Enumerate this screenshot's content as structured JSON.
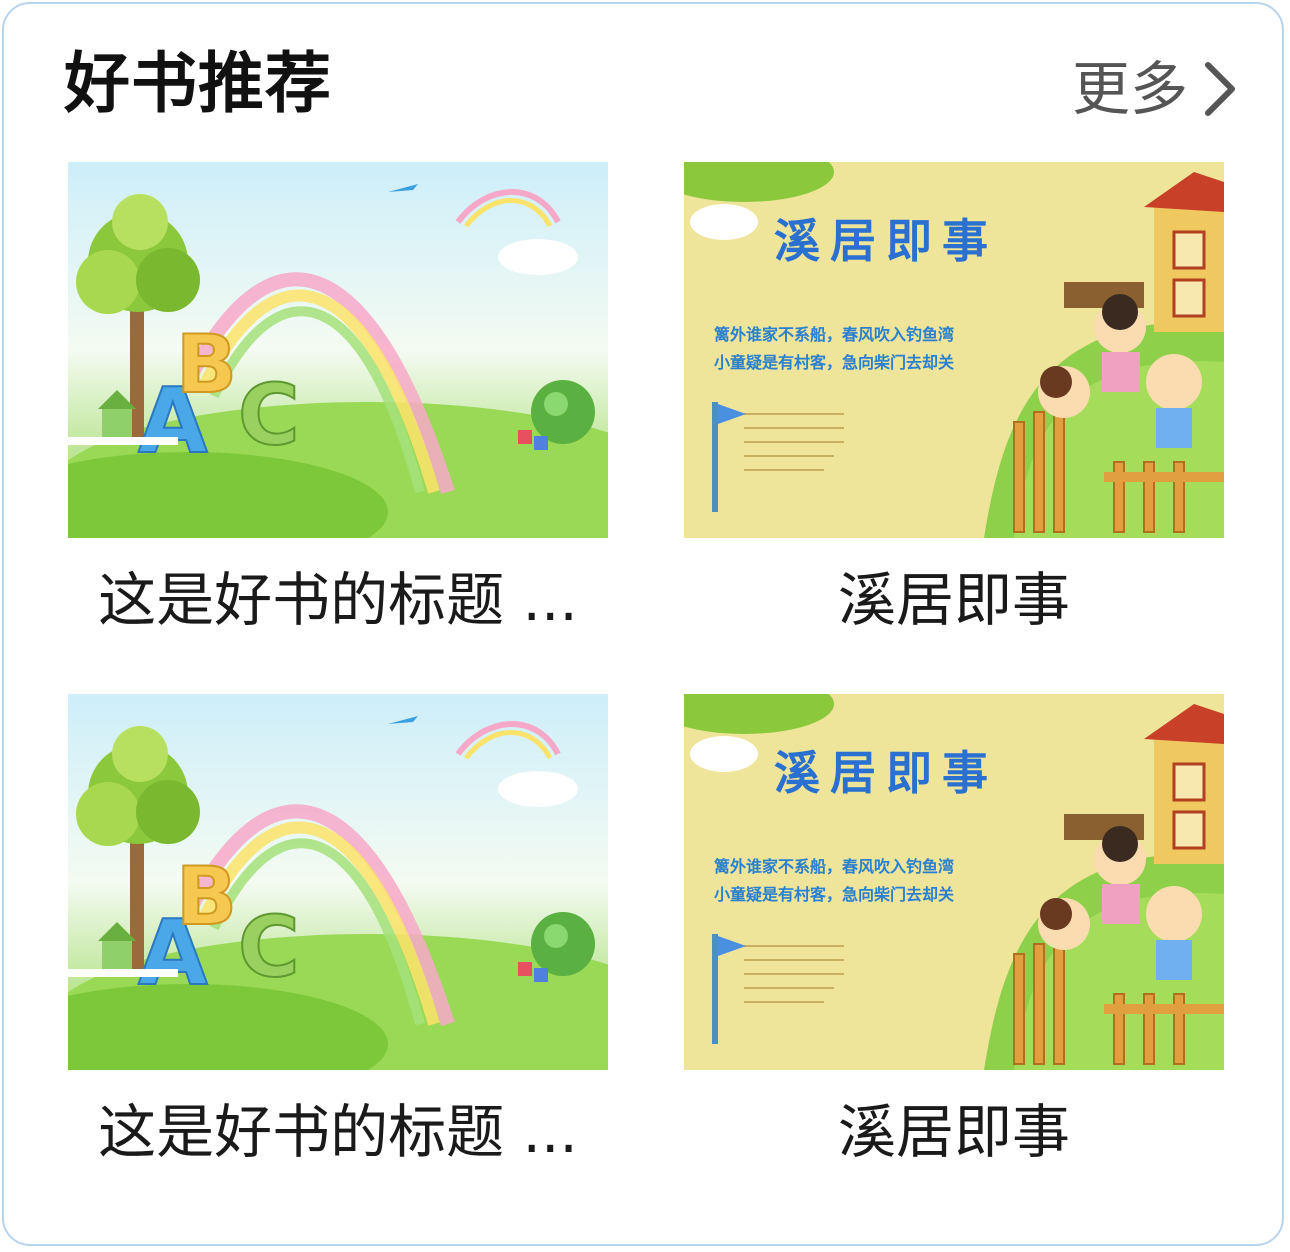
{
  "section": {
    "title": "好书推荐",
    "more_label": "更多",
    "more_icon": "chevron-right-icon"
  },
  "books": [
    {
      "title": "这是好书的标题 ...",
      "cover": {
        "style": "abc-rainbow",
        "letters": [
          "A",
          "B",
          "C"
        ]
      }
    },
    {
      "title": "溪居即事",
      "cover": {
        "style": "poem-village",
        "heading": "溪居即事",
        "line1": "篱外谁家不系船，春风吹入钓鱼湾",
        "line2": "小童疑是有村客，急向柴门去却关"
      }
    },
    {
      "title": "这是好书的标题 ...",
      "cover": {
        "style": "abc-rainbow",
        "letters": [
          "A",
          "B",
          "C"
        ]
      }
    },
    {
      "title": "溪居即事",
      "cover": {
        "style": "poem-village",
        "heading": "溪居即事",
        "line1": "篱外谁家不系船，春风吹入钓鱼湾",
        "line2": "小童疑是有村客，急向柴门去却关"
      }
    }
  ],
  "colors": {
    "card_border": "#b8d4ec",
    "title_text": "#111111",
    "more_text": "#555555"
  }
}
